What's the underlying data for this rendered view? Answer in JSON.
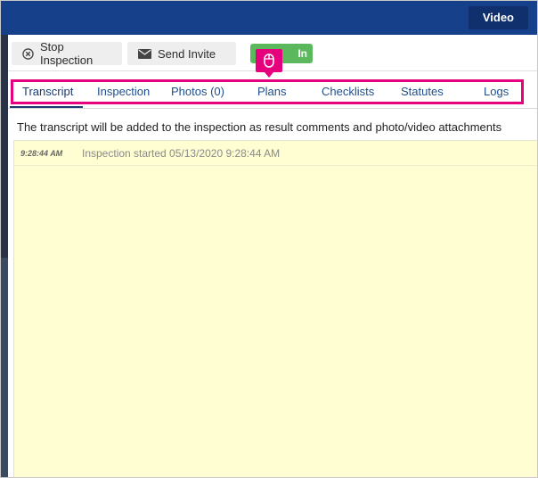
{
  "header": {
    "video_label": "Video"
  },
  "toolbar": {
    "stop_label": "Stop Inspection",
    "invite_label": "Send Invite",
    "status_label": "In Progress"
  },
  "tabs": [
    {
      "label": "Transcript",
      "active": true
    },
    {
      "label": "Inspection"
    },
    {
      "label": "Photos (0)"
    },
    {
      "label": "Plans"
    },
    {
      "label": "Checklists"
    },
    {
      "label": "Statutes"
    },
    {
      "label": "Logs"
    }
  ],
  "info_text": "The transcript will be added to the inspection as result comments and photo/video attachments",
  "transcript": [
    {
      "time": "9:28:44 AM",
      "text": "Inspection started 05/13/2020 9:28:44 AM"
    }
  ],
  "colors": {
    "header_bg": "#17408b",
    "highlight": "#e6007e",
    "status_green": "#5cb85c",
    "transcript_bg": "#fffed3",
    "tab_text": "#1e4d8c"
  },
  "icons": {
    "stop": "close-circle-icon",
    "invite": "envelope-icon",
    "cursor": "mouse-click-icon"
  }
}
